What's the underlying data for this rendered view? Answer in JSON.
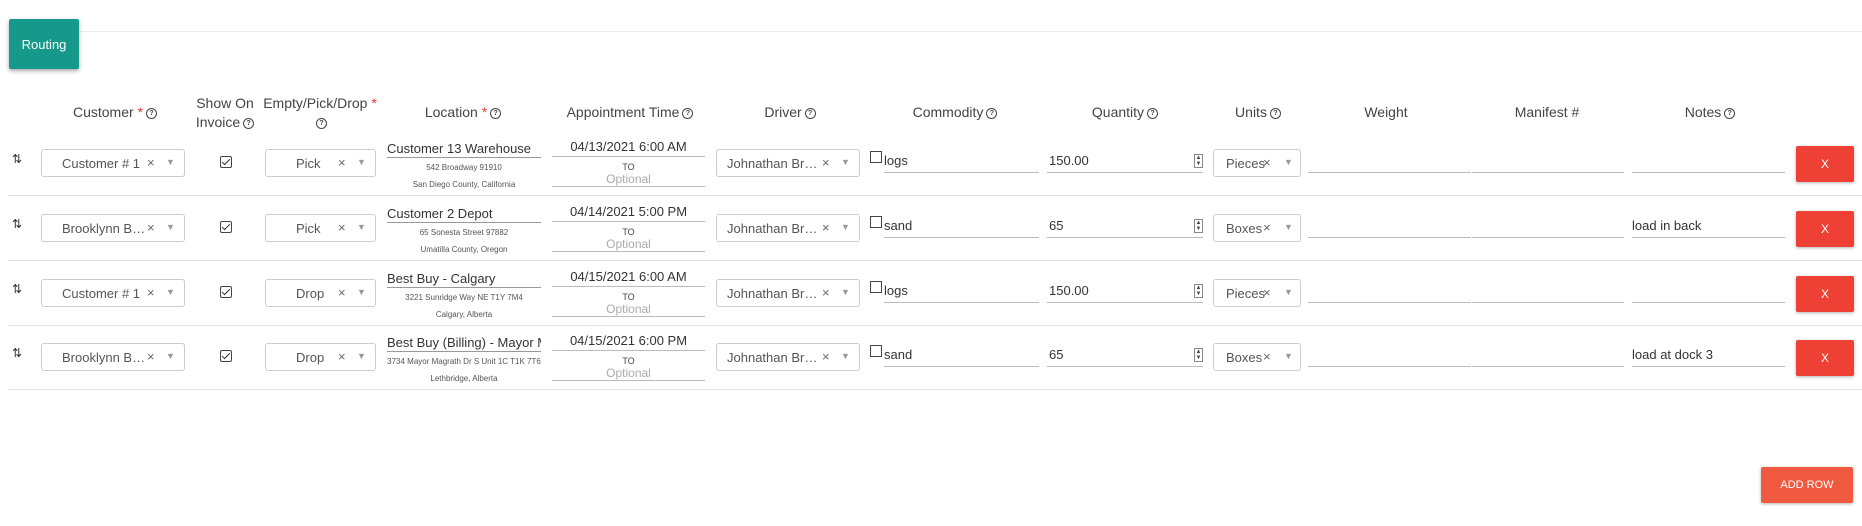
{
  "routing_label": "Routing",
  "headers": {
    "customer": "Customer",
    "show_on_invoice_1": "Show On",
    "show_on_invoice_2": "Invoice",
    "empty_pick_drop": "Empty/Pick/Drop",
    "location": "Location",
    "appointment_time": "Appointment Time",
    "driver": "Driver",
    "commodity": "Commodity",
    "quantity": "Quantity",
    "units": "Units",
    "weight": "Weight",
    "manifest": "Manifest #",
    "notes": "Notes",
    "required_mark": "*",
    "help_glyph": "?"
  },
  "rows": [
    {
      "customer": "Customer # 1",
      "show_on_invoice": true,
      "type": "Pick",
      "location_name": "Customer 13 Warehouse",
      "address": "542 Broadway 91910",
      "county": "San Diego County, California",
      "appt_from": "04/13/2021 6:00 AM",
      "appt_to_label": "TO",
      "appt_to_placeholder": "Optional",
      "driver": "Johnathan Bra...",
      "commodity": "logs",
      "quantity": "150.00",
      "units": "Pieces",
      "weight": "",
      "manifest": "",
      "notes": "",
      "delete_label": "X"
    },
    {
      "customer": "Brooklynn Bre...",
      "show_on_invoice": true,
      "type": "Pick",
      "location_name": "Customer 2 Depot",
      "address": "65 Sonesta Street 97882",
      "county": "Umatilla County, Oregon",
      "appt_from": "04/14/2021 5:00 PM",
      "appt_to_label": "TO",
      "appt_to_placeholder": "Optional",
      "driver": "Johnathan Bra...",
      "commodity": "sand",
      "quantity": "65",
      "units": "Boxes",
      "weight": "",
      "manifest": "",
      "notes": "load in back",
      "delete_label": "X"
    },
    {
      "customer": "Customer # 1",
      "show_on_invoice": true,
      "type": "Drop",
      "location_name": "Best Buy - Calgary",
      "address": "3221 Sunridge Way NE T1Y 7M4",
      "county": "Calgary, Alberta",
      "appt_from": "04/15/2021 6:00 AM",
      "appt_to_label": "TO",
      "appt_to_placeholder": "Optional",
      "driver": "Johnathan Bra...",
      "commodity": "logs",
      "quantity": "150.00",
      "units": "Pieces",
      "weight": "",
      "manifest": "",
      "notes": "",
      "delete_label": "X"
    },
    {
      "customer": "Brooklynn Bre...",
      "show_on_invoice": true,
      "type": "Drop",
      "location_name": "Best Buy (Billing) - Mayor M",
      "address": "3734 Mayor Magrath Dr S Unit 1C T1K 7T6",
      "county": "Lethbridge, Alberta",
      "appt_from": "04/15/2021 6:00 PM",
      "appt_to_label": "TO",
      "appt_to_placeholder": "Optional",
      "driver": "Johnathan Bra...",
      "commodity": "sand",
      "quantity": "65",
      "units": "Boxes",
      "weight": "",
      "manifest": "",
      "notes": "load at dock 3",
      "delete_label": "X"
    }
  ],
  "add_row_label": "ADD ROW",
  "colors": {
    "routing": "#16998a",
    "delete": "#ef4035",
    "add_row": "#f05a40",
    "required": "#e53935"
  }
}
